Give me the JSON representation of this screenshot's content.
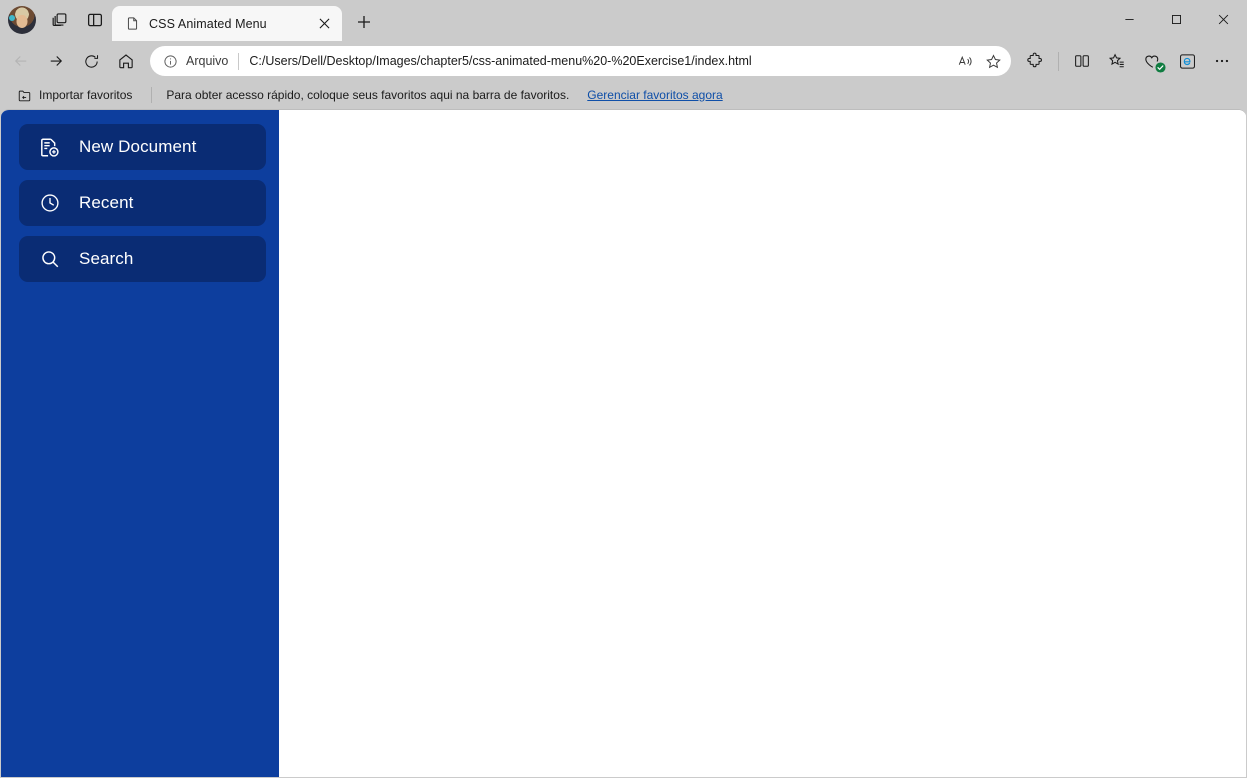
{
  "browser": {
    "profile": {
      "name": "profile-avatar"
    },
    "tab_actions_label": "Tab actions",
    "split_panel_label": "Split screen",
    "tabs": [
      {
        "title": "CSS Animated Menu",
        "favicon": "page-icon",
        "close_label": "Close tab",
        "active": true
      }
    ],
    "new_tab_label": "New tab",
    "window_controls": {
      "minimize": "Minimize",
      "maximize": "Maximize",
      "close": "Close"
    },
    "navigation": {
      "back": "Back",
      "forward": "Forward",
      "refresh": "Refresh",
      "home": "Home"
    },
    "omnibox": {
      "scheme_label": "Arquivo",
      "url": "C:/Users/Dell/Desktop/Images/chapter5/css-animated-menu%20-%20Exercise1/index.html",
      "read_aloud_label": "Read aloud",
      "favorite_label": "Add this page to favorites"
    },
    "toolbar_actions": [
      {
        "name": "extensions-icon",
        "label": "Extensions"
      },
      {
        "name": "split-screen-icon",
        "label": "Split screen"
      },
      {
        "name": "collections-icon",
        "label": "Collections"
      },
      {
        "name": "browser-essentials-icon",
        "label": "Browser essentials"
      },
      {
        "name": "ie-mode-icon",
        "label": "Internet Explorer mode"
      },
      {
        "name": "settings-more-icon",
        "label": "Settings and more"
      }
    ],
    "bookmarks_bar": {
      "import_label": "Importar favoritos",
      "hint": "Para obter acesso rápido, coloque seus favoritos aqui na barra de favoritos.",
      "manage_link": "Gerenciar favoritos agora"
    }
  },
  "page": {
    "title": "CSS Animated Menu",
    "sidebar": {
      "background_color": "#0d3e9e",
      "item_background_color": "#0a2c74",
      "text_color": "#ffffff",
      "items": [
        {
          "label": "New Document",
          "icon": "new-document-icon"
        },
        {
          "label": "Recent",
          "icon": "clock-icon"
        },
        {
          "label": "Search",
          "icon": "search-icon"
        }
      ]
    },
    "content": {
      "background_color": "#ffffff",
      "text": ""
    }
  }
}
